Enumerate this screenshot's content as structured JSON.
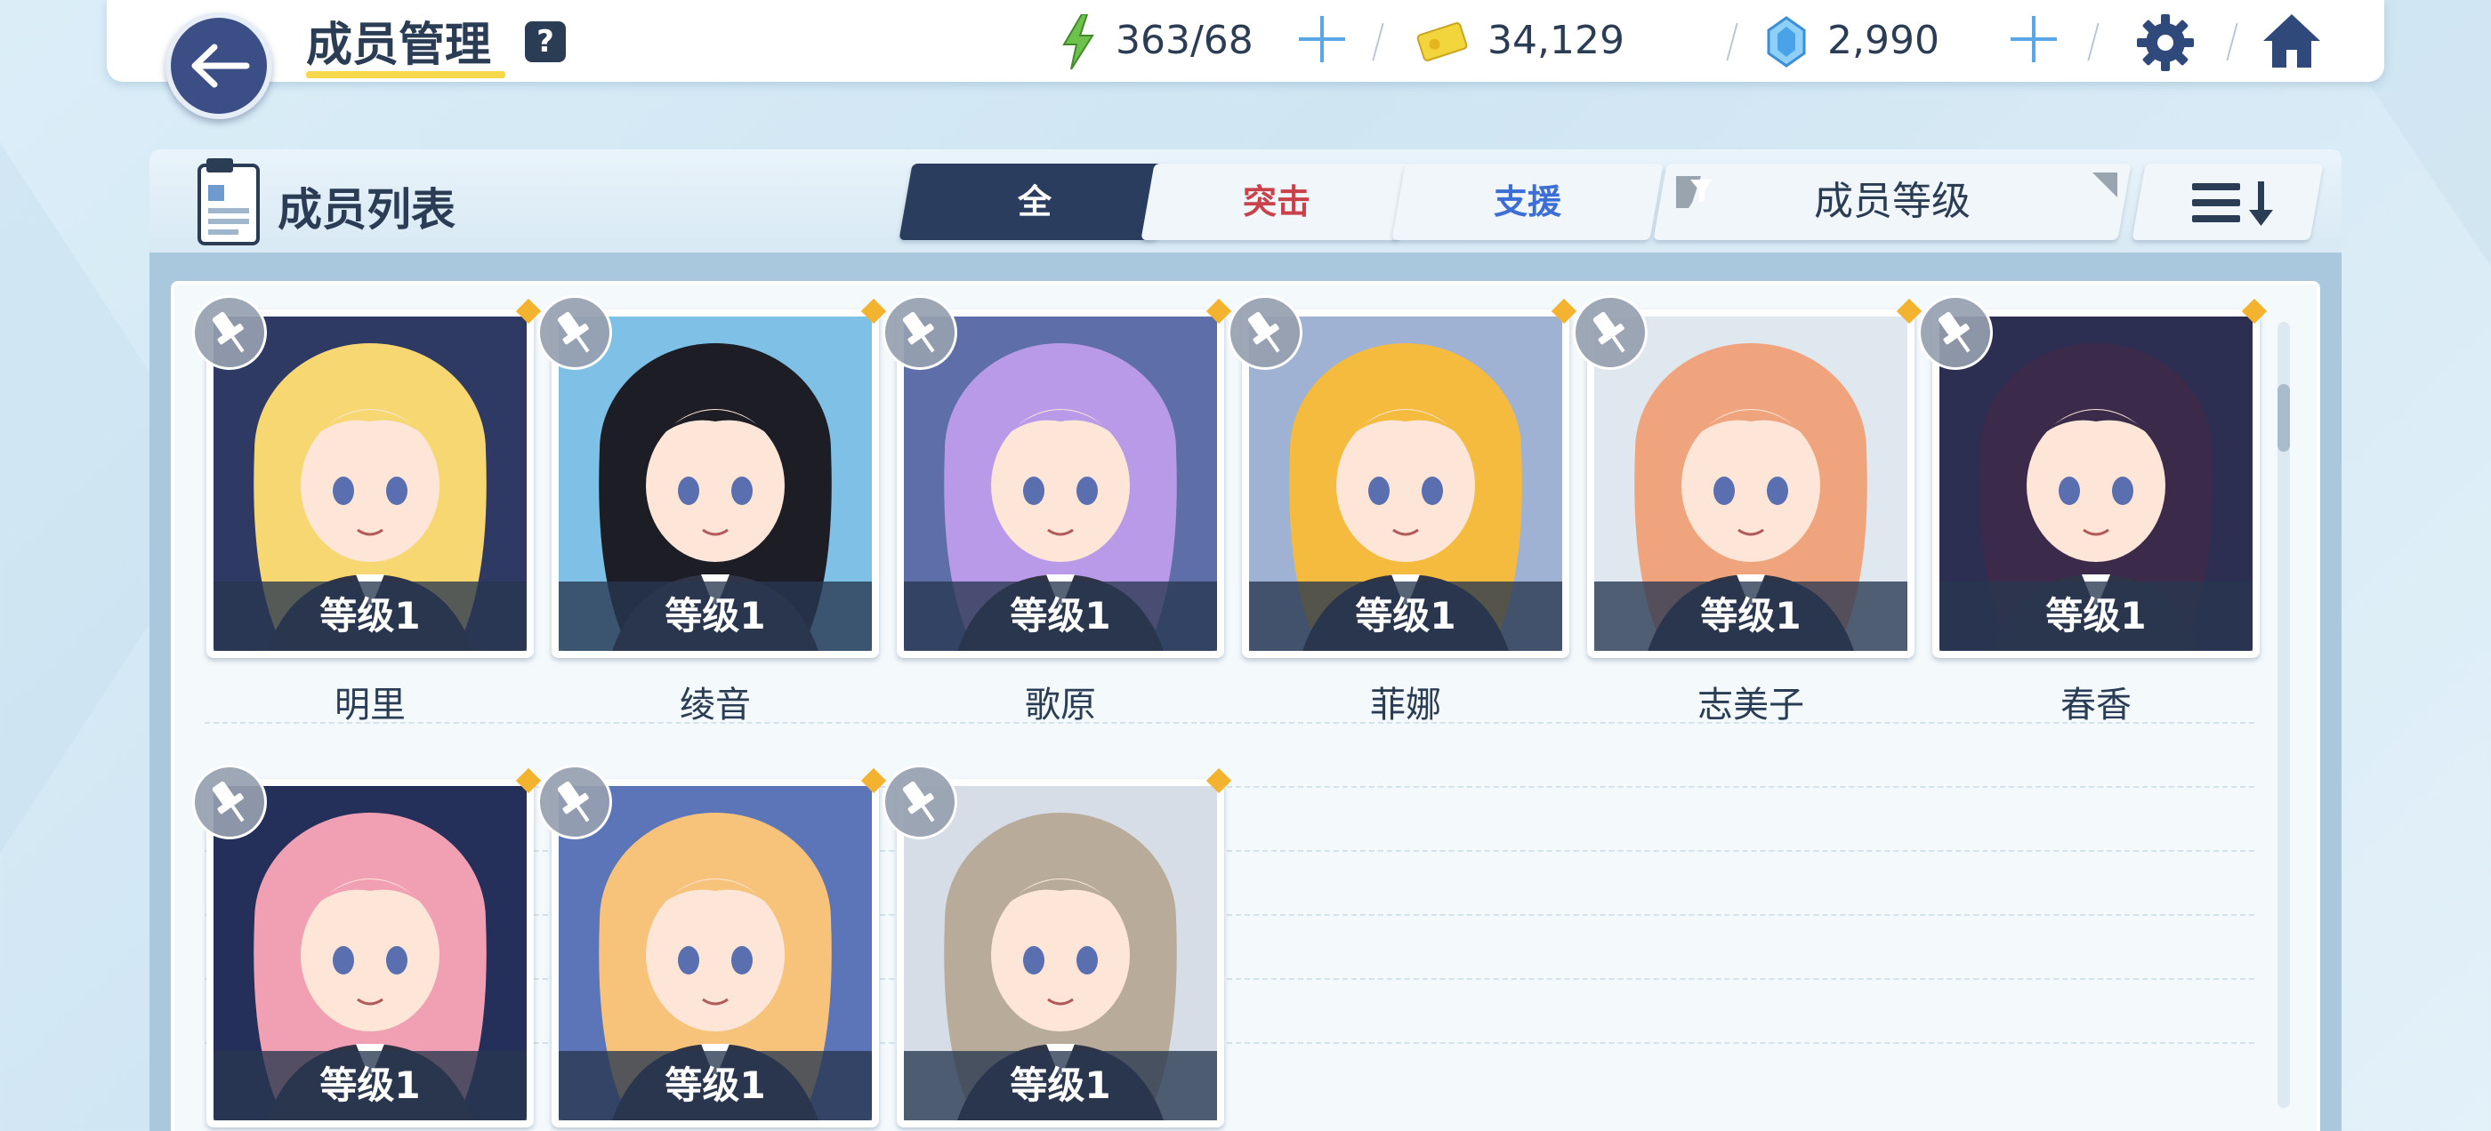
{
  "header": {
    "title": "成员管理",
    "help": "?",
    "ap_value": "363/68",
    "credits_value": "34,129",
    "gems_value": "2,990"
  },
  "panel": {
    "title": "成员列表",
    "tabs": [
      {
        "label": "全",
        "active": true,
        "color": "#ffffff"
      },
      {
        "label": "突击",
        "active": false,
        "color": "#c8414b"
      },
      {
        "label": "支援",
        "active": false,
        "color": "#3d6ed6"
      }
    ],
    "filter_label": "成员等级"
  },
  "members": [
    {
      "name": "明里",
      "level": "等级1",
      "hair": "#f7d772",
      "bg": "#2e3a63"
    },
    {
      "name": "绫音",
      "level": "等级1",
      "hair": "#1d1d26",
      "bg": "#7fc0e6"
    },
    {
      "name": "歌原",
      "level": "等级1",
      "hair": "#b99ae8",
      "bg": "#5d6ea8"
    },
    {
      "name": "菲娜",
      "level": "等级1",
      "hair": "#f5bb3e",
      "bg": "#9fb2d4"
    },
    {
      "name": "志美子",
      "level": "等级1",
      "hair": "#f0a47e",
      "bg": "#dfe7ef"
    },
    {
      "name": "春香",
      "level": "等级1",
      "hair": "#3b2a4a",
      "bg": "#2d2f52"
    },
    {
      "name": "",
      "level": "等级1",
      "hair": "#f0a0b2",
      "bg": "#25305a"
    },
    {
      "name": "",
      "level": "等级1",
      "hair": "#f7c27a",
      "bg": "#5c74b8"
    },
    {
      "name": "",
      "level": "等级1",
      "hair": "#b9ab9a",
      "bg": "#d6dde6"
    }
  ],
  "icons": {
    "back": "arrow-left-icon",
    "ap": "lightning-icon",
    "credits": "credit-card-icon",
    "gems": "gem-icon",
    "settings": "gear-icon",
    "home": "home-icon",
    "filter": "funnel-icon",
    "sort": "sort-icon",
    "pin": "pin-icon",
    "list": "member-list-icon"
  },
  "colors": {
    "accent_dark": "#2b3d5e",
    "plus": "#5aa7e6",
    "ap": "#6cc24a",
    "credit": "#f2d43c",
    "gem": "#4aa3e8"
  }
}
